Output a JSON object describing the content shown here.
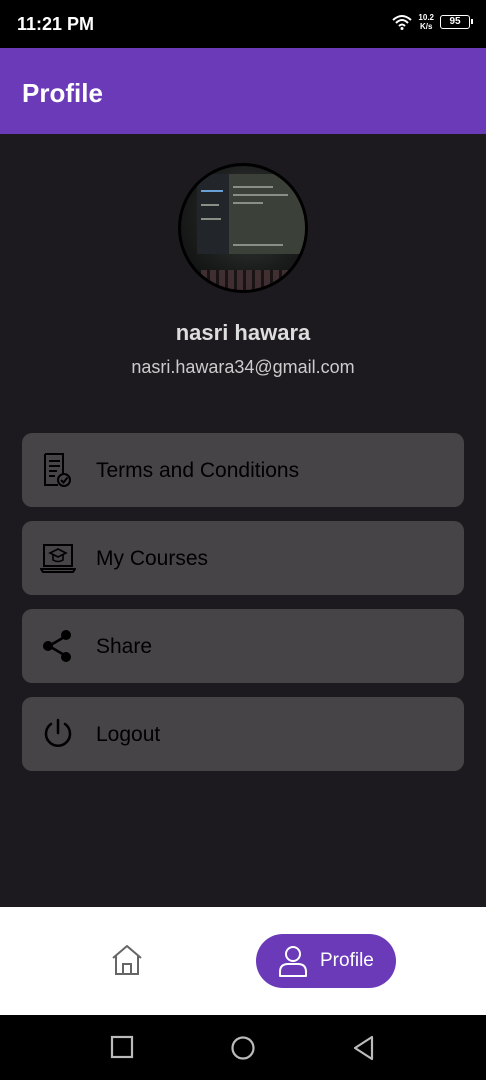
{
  "status_bar": {
    "time": "11:21 PM",
    "speed_value": "10.2",
    "speed_unit": "K/s",
    "battery": "95"
  },
  "app_bar": {
    "title": "Profile"
  },
  "profile": {
    "name": "nasri hawara",
    "email": "nasri.hawara34@gmail.com"
  },
  "menu": [
    {
      "label": "Terms and Conditions",
      "icon": "document-check-icon"
    },
    {
      "label": "My Courses",
      "icon": "laptop-graduation-icon"
    },
    {
      "label": "Share",
      "icon": "share-icon"
    },
    {
      "label": "Logout",
      "icon": "power-icon"
    }
  ],
  "bottom_nav": {
    "home_icon": "home-icon",
    "profile_label": "Profile"
  },
  "colors": {
    "accent": "#6a3ab8",
    "background": "#1c191f",
    "card": "#464446"
  }
}
